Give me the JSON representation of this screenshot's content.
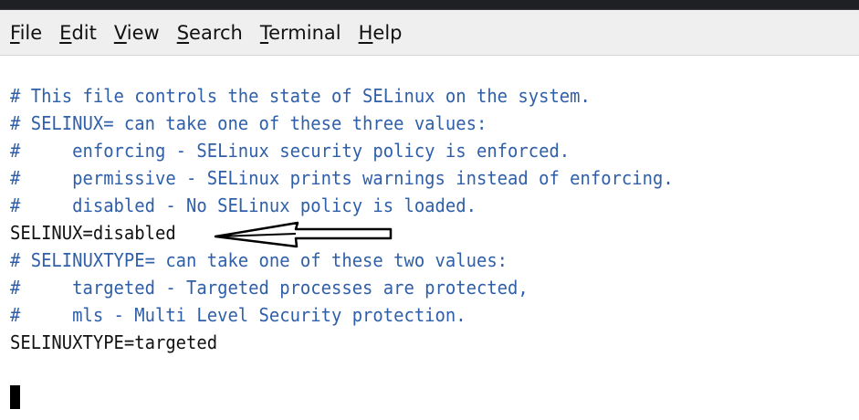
{
  "menubar": {
    "items": [
      {
        "mnemonic": "F",
        "rest": "ile"
      },
      {
        "mnemonic": "E",
        "rest": "dit"
      },
      {
        "mnemonic": "V",
        "rest": "iew"
      },
      {
        "mnemonic": "S",
        "rest": "earch"
      },
      {
        "mnemonic": "T",
        "rest": "erminal"
      },
      {
        "mnemonic": "H",
        "rest": "elp"
      }
    ]
  },
  "terminal": {
    "lines": [
      "# This file controls the state of SELinux on the system.",
      "# SELINUX= can take one of these three values:",
      "#     enforcing - SELinux security policy is enforced.",
      "#     permissive - SELinux prints warnings instead of enforcing.",
      "#     disabled - No SELinux policy is loaded.",
      "SELINUX=disabled",
      "# SELINUXTYPE= can take one of these two values:",
      "#     targeted - Targeted processes are protected,",
      "#     mls - Multi Level Security protection.",
      "SELINUXTYPE=targeted"
    ]
  },
  "colors": {
    "comment": "#2f5fa8",
    "plain": "#111111",
    "menubar_bg": "#efefef",
    "terminal_bg": "#ffffff"
  }
}
